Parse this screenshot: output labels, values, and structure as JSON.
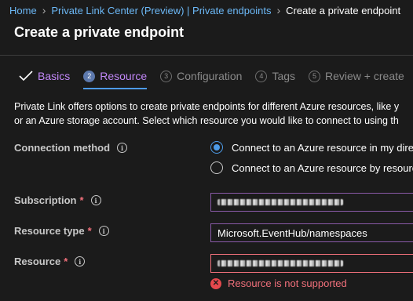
{
  "breadcrumb": {
    "items": [
      "Home",
      "Private Link Center (Preview) | Private endpoints"
    ],
    "current": "Create a private endpoint",
    "separator": "›"
  },
  "page_title": "Create a private endpoint",
  "tabs": [
    {
      "marker": "✓",
      "label": "Basics",
      "state": "done"
    },
    {
      "marker": "2",
      "label": "Resource",
      "state": "active"
    },
    {
      "marker": "3",
      "label": "Configuration",
      "state": "future"
    },
    {
      "marker": "4",
      "label": "Tags",
      "state": "future"
    },
    {
      "marker": "5",
      "label": "Review + create",
      "state": "future"
    }
  ],
  "description": [
    "Private Link offers options to create private endpoints for different Azure resources, like y",
    "or an Azure storage account. Select which resource you would like to connect to using th"
  ],
  "form": {
    "connection_method": {
      "label": "Connection method",
      "options": [
        {
          "label": "Connect to an Azure resource in my dire",
          "checked": true
        },
        {
          "label": "Connect to an Azure resource by resourc",
          "checked": false
        }
      ]
    },
    "subscription": {
      "label": "Subscription",
      "required_mark": "*",
      "value_redacted": true
    },
    "resource_type": {
      "label": "Resource type",
      "required_mark": "*",
      "value": "Microsoft.EventHub/namespaces"
    },
    "resource": {
      "label": "Resource",
      "required_mark": "*",
      "value_redacted": true,
      "error": "Resource is not supported"
    }
  },
  "icons": {
    "info": "i",
    "error": "✕"
  },
  "colors": {
    "link": "#6cb8f6",
    "accent_purple": "#c187f7",
    "active_blue": "#4d9be8",
    "error": "#f1707b",
    "background": "#1b1b1b"
  }
}
